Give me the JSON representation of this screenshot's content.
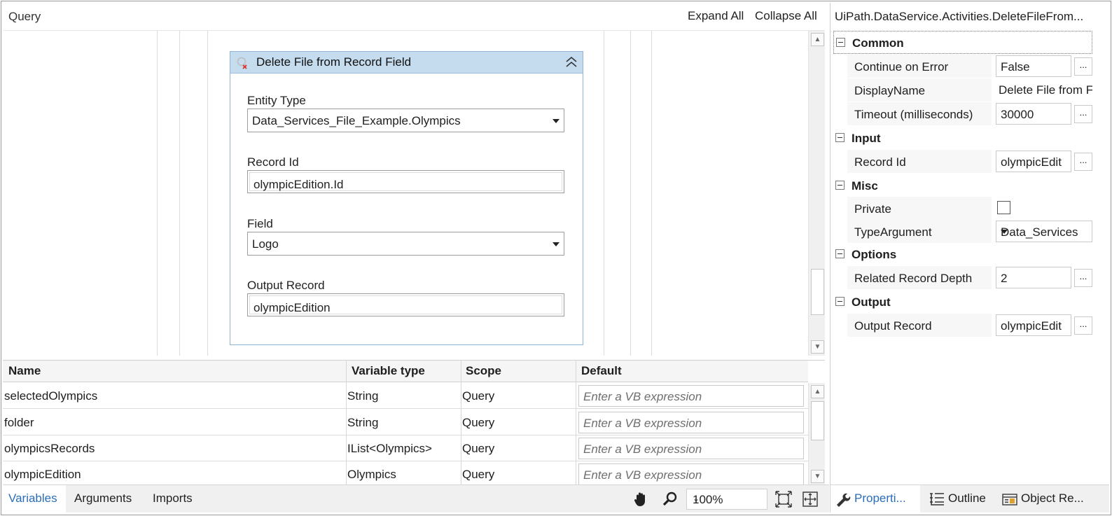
{
  "designer": {
    "breadcrumb": "Query",
    "expand_all": "Expand All",
    "collapse_all": "Collapse All"
  },
  "activity": {
    "title": "Delete File from Record Field",
    "entity_type_label": "Entity Type",
    "entity_type_value": "Data_Services_File_Example.Olympics",
    "record_id_label": "Record Id",
    "record_id_value": "olympicEdition.Id",
    "field_label": "Field",
    "field_value": "Logo",
    "output_record_label": "Output Record",
    "output_record_value": "olympicEdition"
  },
  "variables": {
    "columns": [
      "Name",
      "Variable type",
      "Scope",
      "Default"
    ],
    "rows": [
      {
        "name": "selectedOlympics",
        "type": "String",
        "scope": "Query",
        "default": "Enter a VB expression"
      },
      {
        "name": "folder",
        "type": "String",
        "scope": "Query",
        "default": "Enter a VB expression"
      },
      {
        "name": "olympicsRecords",
        "type": "IList<Olympics>",
        "scope": "Query",
        "default": "Enter a VB expression"
      },
      {
        "name": "olympicEdition",
        "type": "Olympics",
        "scope": "Query",
        "default": "Enter a VB expression"
      }
    ]
  },
  "bottom_tabs": {
    "variables": "Variables",
    "arguments": "Arguments",
    "imports": "Imports",
    "zoom": "100%",
    "icons": [
      "hand-pan-icon",
      "zoom-magnifier-icon",
      "fit-to-screen-icon",
      "overview-icon"
    ]
  },
  "properties": {
    "title": "UiPath.DataService.Activities.DeleteFileFrom...",
    "categories": {
      "common": "Common",
      "input": "Input",
      "misc": "Misc",
      "options": "Options",
      "output": "Output"
    },
    "rows": {
      "continue_on_error": {
        "label": "Continue on Error",
        "value": "False"
      },
      "display_name": {
        "label": "DisplayName",
        "value": "Delete File from F"
      },
      "timeout": {
        "label": "Timeout (milliseconds)",
        "value": "30000"
      },
      "record_id": {
        "label": "Record Id",
        "value": "olympicEdit"
      },
      "private": {
        "label": "Private",
        "checked": false
      },
      "type_argument": {
        "label": "TypeArgument",
        "value": "Data_Services"
      },
      "related_depth": {
        "label": "Related Record Depth",
        "value": "2"
      },
      "output_record": {
        "label": "Output Record",
        "value": "olympicEdit"
      }
    },
    "ellipsis": "...",
    "tabs": {
      "properties": "Properti...",
      "outline": "Outline",
      "object_repo": "Object Re..."
    }
  },
  "colors": {
    "activity_header": "#c5dcef",
    "activity_border": "#8fb3d6",
    "active_tab_text": "#2a6db8"
  }
}
